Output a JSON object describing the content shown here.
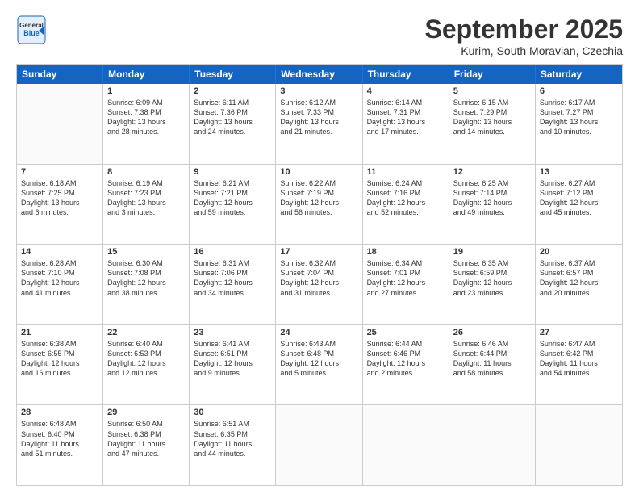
{
  "header": {
    "logo": {
      "general": "General",
      "blue": "Blue",
      "icon": "▶"
    },
    "title": "September 2025",
    "subtitle": "Kurim, South Moravian, Czechia"
  },
  "days_of_week": [
    "Sunday",
    "Monday",
    "Tuesday",
    "Wednesday",
    "Thursday",
    "Friday",
    "Saturday"
  ],
  "weeks": [
    [
      {
        "day": "",
        "lines": []
      },
      {
        "day": "1",
        "lines": [
          "Sunrise: 6:09 AM",
          "Sunset: 7:38 PM",
          "Daylight: 13 hours",
          "and 28 minutes."
        ]
      },
      {
        "day": "2",
        "lines": [
          "Sunrise: 6:11 AM",
          "Sunset: 7:36 PM",
          "Daylight: 13 hours",
          "and 24 minutes."
        ]
      },
      {
        "day": "3",
        "lines": [
          "Sunrise: 6:12 AM",
          "Sunset: 7:33 PM",
          "Daylight: 13 hours",
          "and 21 minutes."
        ]
      },
      {
        "day": "4",
        "lines": [
          "Sunrise: 6:14 AM",
          "Sunset: 7:31 PM",
          "Daylight: 13 hours",
          "and 17 minutes."
        ]
      },
      {
        "day": "5",
        "lines": [
          "Sunrise: 6:15 AM",
          "Sunset: 7:29 PM",
          "Daylight: 13 hours",
          "and 14 minutes."
        ]
      },
      {
        "day": "6",
        "lines": [
          "Sunrise: 6:17 AM",
          "Sunset: 7:27 PM",
          "Daylight: 13 hours",
          "and 10 minutes."
        ]
      }
    ],
    [
      {
        "day": "7",
        "lines": [
          "Sunrise: 6:18 AM",
          "Sunset: 7:25 PM",
          "Daylight: 13 hours",
          "and 6 minutes."
        ]
      },
      {
        "day": "8",
        "lines": [
          "Sunrise: 6:19 AM",
          "Sunset: 7:23 PM",
          "Daylight: 13 hours",
          "and 3 minutes."
        ]
      },
      {
        "day": "9",
        "lines": [
          "Sunrise: 6:21 AM",
          "Sunset: 7:21 PM",
          "Daylight: 12 hours",
          "and 59 minutes."
        ]
      },
      {
        "day": "10",
        "lines": [
          "Sunrise: 6:22 AM",
          "Sunset: 7:19 PM",
          "Daylight: 12 hours",
          "and 56 minutes."
        ]
      },
      {
        "day": "11",
        "lines": [
          "Sunrise: 6:24 AM",
          "Sunset: 7:16 PM",
          "Daylight: 12 hours",
          "and 52 minutes."
        ]
      },
      {
        "day": "12",
        "lines": [
          "Sunrise: 6:25 AM",
          "Sunset: 7:14 PM",
          "Daylight: 12 hours",
          "and 49 minutes."
        ]
      },
      {
        "day": "13",
        "lines": [
          "Sunrise: 6:27 AM",
          "Sunset: 7:12 PM",
          "Daylight: 12 hours",
          "and 45 minutes."
        ]
      }
    ],
    [
      {
        "day": "14",
        "lines": [
          "Sunrise: 6:28 AM",
          "Sunset: 7:10 PM",
          "Daylight: 12 hours",
          "and 41 minutes."
        ]
      },
      {
        "day": "15",
        "lines": [
          "Sunrise: 6:30 AM",
          "Sunset: 7:08 PM",
          "Daylight: 12 hours",
          "and 38 minutes."
        ]
      },
      {
        "day": "16",
        "lines": [
          "Sunrise: 6:31 AM",
          "Sunset: 7:06 PM",
          "Daylight: 12 hours",
          "and 34 minutes."
        ]
      },
      {
        "day": "17",
        "lines": [
          "Sunrise: 6:32 AM",
          "Sunset: 7:04 PM",
          "Daylight: 12 hours",
          "and 31 minutes."
        ]
      },
      {
        "day": "18",
        "lines": [
          "Sunrise: 6:34 AM",
          "Sunset: 7:01 PM",
          "Daylight: 12 hours",
          "and 27 minutes."
        ]
      },
      {
        "day": "19",
        "lines": [
          "Sunrise: 6:35 AM",
          "Sunset: 6:59 PM",
          "Daylight: 12 hours",
          "and 23 minutes."
        ]
      },
      {
        "day": "20",
        "lines": [
          "Sunrise: 6:37 AM",
          "Sunset: 6:57 PM",
          "Daylight: 12 hours",
          "and 20 minutes."
        ]
      }
    ],
    [
      {
        "day": "21",
        "lines": [
          "Sunrise: 6:38 AM",
          "Sunset: 6:55 PM",
          "Daylight: 12 hours",
          "and 16 minutes."
        ]
      },
      {
        "day": "22",
        "lines": [
          "Sunrise: 6:40 AM",
          "Sunset: 6:53 PM",
          "Daylight: 12 hours",
          "and 12 minutes."
        ]
      },
      {
        "day": "23",
        "lines": [
          "Sunrise: 6:41 AM",
          "Sunset: 6:51 PM",
          "Daylight: 12 hours",
          "and 9 minutes."
        ]
      },
      {
        "day": "24",
        "lines": [
          "Sunrise: 6:43 AM",
          "Sunset: 6:48 PM",
          "Daylight: 12 hours",
          "and 5 minutes."
        ]
      },
      {
        "day": "25",
        "lines": [
          "Sunrise: 6:44 AM",
          "Sunset: 6:46 PM",
          "Daylight: 12 hours",
          "and 2 minutes."
        ]
      },
      {
        "day": "26",
        "lines": [
          "Sunrise: 6:46 AM",
          "Sunset: 6:44 PM",
          "Daylight: 11 hours",
          "and 58 minutes."
        ]
      },
      {
        "day": "27",
        "lines": [
          "Sunrise: 6:47 AM",
          "Sunset: 6:42 PM",
          "Daylight: 11 hours",
          "and 54 minutes."
        ]
      }
    ],
    [
      {
        "day": "28",
        "lines": [
          "Sunrise: 6:48 AM",
          "Sunset: 6:40 PM",
          "Daylight: 11 hours",
          "and 51 minutes."
        ]
      },
      {
        "day": "29",
        "lines": [
          "Sunrise: 6:50 AM",
          "Sunset: 6:38 PM",
          "Daylight: 11 hours",
          "and 47 minutes."
        ]
      },
      {
        "day": "30",
        "lines": [
          "Sunrise: 6:51 AM",
          "Sunset: 6:35 PM",
          "Daylight: 11 hours",
          "and 44 minutes."
        ]
      },
      {
        "day": "",
        "lines": []
      },
      {
        "day": "",
        "lines": []
      },
      {
        "day": "",
        "lines": []
      },
      {
        "day": "",
        "lines": []
      }
    ]
  ]
}
